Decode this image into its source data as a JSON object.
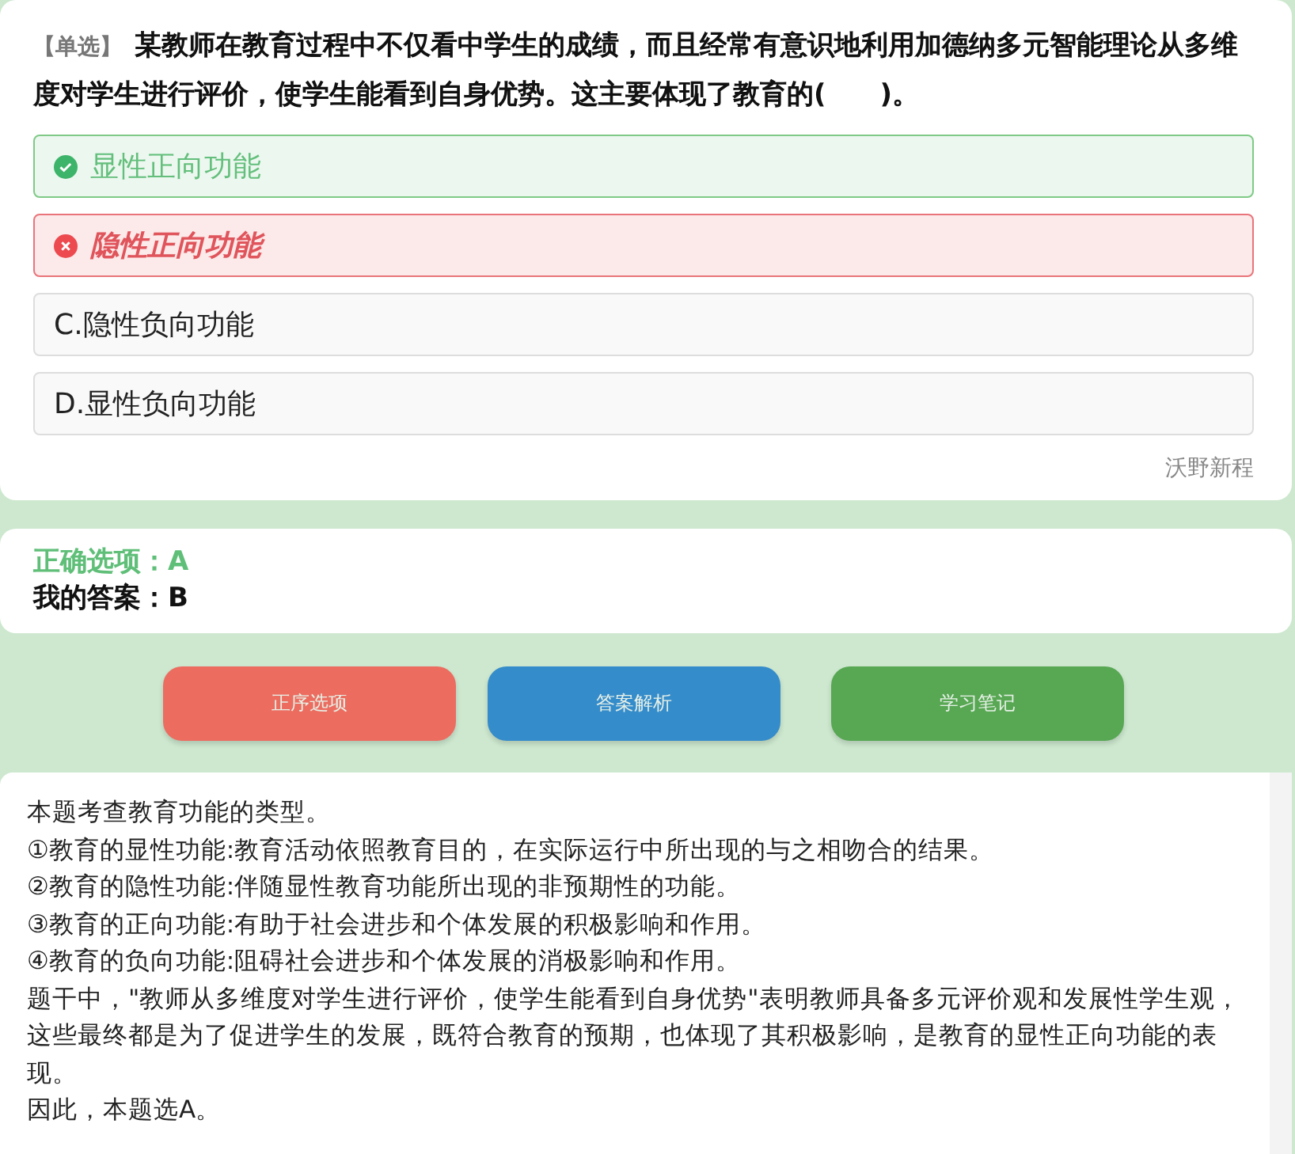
{
  "question": {
    "tag": "【单选】",
    "text": "某教师在教育过程中不仅看中学生的成绩，而且经常有意识地利用加德纳多元智能理论从多维度对学生进行评价，使学生能看到自身优势。这主要体现了教育的(　　)。"
  },
  "options": [
    {
      "kind": "correct",
      "label": "显性正向功能"
    },
    {
      "kind": "wrong",
      "label": "隐性正向功能"
    },
    {
      "kind": "plain",
      "label": "C.隐性负向功能"
    },
    {
      "kind": "plain",
      "label": "D.显性负向功能"
    }
  ],
  "source": "沃野新程",
  "result": {
    "correct": "正确选项：A",
    "mine": "我的答案：B"
  },
  "buttons": [
    {
      "label": "正序选项",
      "color": "#ec6c60"
    },
    {
      "label": "答案解析",
      "color": "#358ccb"
    },
    {
      "label": "学习笔记",
      "color": "#57a753"
    }
  ],
  "explanation": [
    "本题考查教育功能的类型。",
    "①教育的显性功能:教育活动依照教育目的，在实际运行中所出现的与之相吻合的结果。",
    "②教育的隐性功能:伴随显性教育功能所出现的非预期性的功能。",
    "③教育的正向功能:有助于社会进步和个体发展的积极影响和作用。",
    "④教育的负向功能:阻碍社会进步和个体发展的消极影响和作用。",
    "题干中，\"教师从多维度对学生进行评价，使学生能看到自身优势\"表明教师具备多元评价观和发展性学生观，这些最终都是为了促进学生的发展，既符合教育的预期，也体现了其积极影响，是教育的显性正向功能的表现。",
    "因此，本题选A。"
  ]
}
